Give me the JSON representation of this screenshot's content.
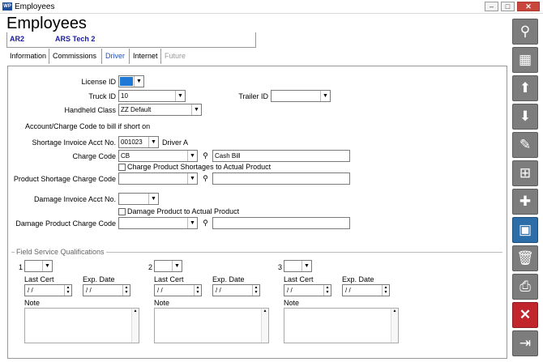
{
  "window": {
    "icon_text": "WP",
    "title": "Employees"
  },
  "header": {
    "title": "Employees",
    "record_id": "AR2",
    "record_name": "ARS Tech 2"
  },
  "tabs": [
    {
      "label": "Information",
      "state": "normal"
    },
    {
      "label": "Commissions",
      "state": "normal"
    },
    {
      "label": "Driver",
      "state": "active"
    },
    {
      "label": "Internet",
      "state": "normal"
    },
    {
      "label": "Future",
      "state": "disabled"
    }
  ],
  "driver": {
    "license_id_label": "License ID",
    "license_id_value": "",
    "truck_id_label": "Truck ID",
    "truck_id_value": "10",
    "trailer_id_label": "Trailer ID",
    "trailer_id_value": "",
    "handheld_class_label": "Handheld Class",
    "handheld_class_value": "ZZ Default",
    "account_charge_text": "Account/Charge Code to bill if short on",
    "shortage_invoice_label": "Shortage Invoice Acct No.",
    "shortage_invoice_value": "001023",
    "shortage_invoice_name": "Driver A",
    "charge_code_label": "Charge Code",
    "charge_code_value": "CB",
    "charge_code_desc": "Cash Bill",
    "charge_shortages_label": "Charge Product Shortages to Actual Product",
    "product_shortage_label": "Product  Shortage Charge Code",
    "damage_invoice_label": "Damage Invoice Acct No.",
    "damage_to_actual_label": "Damage Product to Actual Product",
    "damage_product_label": "Damage Product  Charge Code"
  },
  "qualifications": {
    "legend": "Field Service Qualifications",
    "items": [
      {
        "number": "1",
        "last_cert_label": "Last Cert",
        "last_cert_value": "/ /",
        "exp_date_label": "Exp. Date",
        "exp_date_value": "/ /",
        "note_label": "Note"
      },
      {
        "number": "2",
        "last_cert_label": "Last Cert",
        "last_cert_value": "/ /",
        "exp_date_label": "Exp. Date",
        "exp_date_value": "/ /",
        "note_label": "Note"
      },
      {
        "number": "3",
        "last_cert_label": "Last Cert",
        "last_cert_value": "/ /",
        "exp_date_label": "Exp. Date",
        "exp_date_value": "/ /",
        "note_label": "Note"
      }
    ]
  },
  "toolbar": {
    "icons": [
      "search-icon",
      "grid-icon",
      "arrow-up-icon",
      "arrow-down-icon",
      "pencil-icon",
      "add-document-icon",
      "new-record-icon",
      "save-icon",
      "trash-icon",
      "print-icon",
      "close-icon",
      "exit-icon"
    ]
  },
  "colors": {
    "accent": "#2d6ea8",
    "tab_active": "#1f4ec4",
    "license_swatch": "#1e78d6",
    "danger": "#c0262b"
  }
}
